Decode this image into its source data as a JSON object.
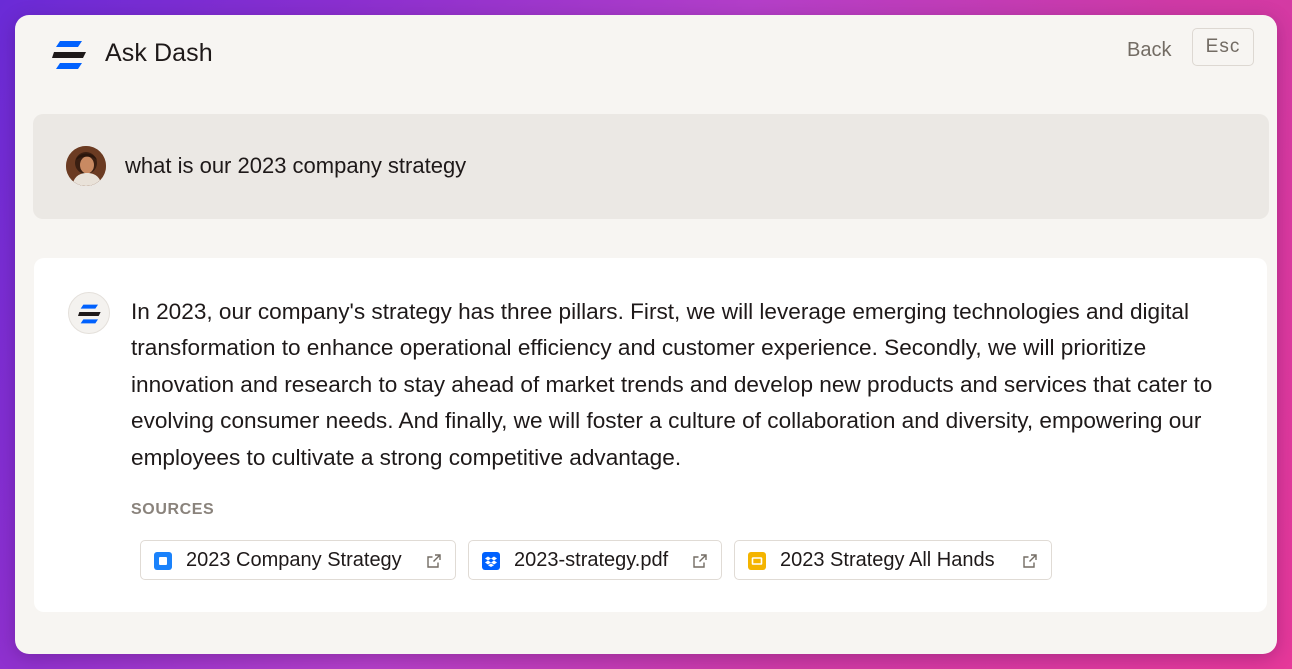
{
  "app": {
    "title": "Ask Dash"
  },
  "header": {
    "back_label": "Back",
    "esc_label": "Esc"
  },
  "query": {
    "text": "what is our 2023 company strategy"
  },
  "answer": {
    "text": "In 2023, our company's strategy has three pillars. First, we will leverage emerging technologies and digital transformation to enhance operational efficiency and customer experience. Secondly, we will prioritize innovation and research to stay ahead of market trends and develop new products and services that cater to evolving consumer needs. And finally, we will foster a culture of collaboration and diversity, empowering our employees to cultivate a strong competitive advantage.",
    "sources_label": "SOURCES",
    "sources": [
      {
        "label": "2023 Company Strategy",
        "icon": "doc-blue-square-icon",
        "color": "#1a82fb"
      },
      {
        "label": "2023-strategy.pdf",
        "icon": "dropbox-icon",
        "color": "#0061fe"
      },
      {
        "label": "2023 Strategy All Hands",
        "icon": "slides-yellow-icon",
        "color": "#f4b400"
      }
    ]
  },
  "colors": {
    "accent_blue": "#0061fe",
    "window_bg": "#f7f5f2",
    "query_bg": "#ebe8e4",
    "text": "#1e1919",
    "muted": "#736c64"
  }
}
